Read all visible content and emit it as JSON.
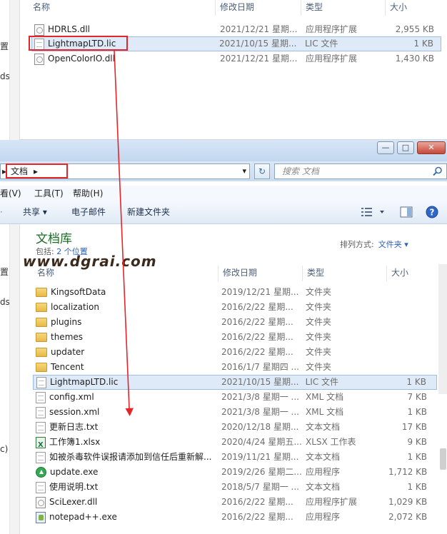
{
  "top_window": {
    "left_labels": [
      "置",
      "ds"
    ],
    "columns": [
      "名称",
      "修改日期",
      "类型",
      "大小"
    ],
    "files": [
      {
        "name": "HDRLS.dll",
        "date": "2021/12/21 星期...",
        "type": "应用程序扩展",
        "size": "2,955 KB",
        "icon": "dll-icon"
      },
      {
        "name": "LightmapLTD.lic",
        "date": "2021/10/15 星期...",
        "type": "LIC 文件",
        "size": "1 KB",
        "icon": "doc-icon"
      },
      {
        "name": "OpenColorIO.dll",
        "date": "2021/12/21 星期...",
        "type": "应用程序扩展",
        "size": "1,430 KB",
        "icon": "dll-icon"
      }
    ]
  },
  "bottom_window": {
    "window_buttons": {
      "min": "—",
      "max": "□",
      "close": "✕"
    },
    "breadcrumb": "文档",
    "breadcrumb_arrow_left": "▸",
    "breadcrumb_arrow_right": "▸",
    "dropdown_arrow": "▾",
    "refresh": "↻",
    "search_placeholder": "搜索 文档",
    "menu": [
      {
        "label": "看(V)"
      },
      {
        "label": "工具(T)"
      },
      {
        "label": "帮助(H)"
      }
    ],
    "commands": {
      "share": "共享 ▾",
      "email": "电子邮件",
      "new_folder": "新建文件夹"
    },
    "left_labels": [
      "置",
      "ds",
      "c)"
    ],
    "library_title": "文档库",
    "library_sub_prefix": "包括:",
    "library_sub_link": "2 个位置",
    "arrange_label": "排列方式:",
    "arrange_value": "文件夹 ▾",
    "columns": [
      "名称",
      "修改日期",
      "类型",
      "大小"
    ],
    "files": [
      {
        "name": "KingsoftData",
        "date": "2019/12/21 星期...",
        "type": "文件夹",
        "size": "",
        "icon": "folder-icon"
      },
      {
        "name": "localization",
        "date": "2016/2/22 星期...",
        "type": "文件夹",
        "size": "",
        "icon": "folder-icon"
      },
      {
        "name": "plugins",
        "date": "2016/2/22 星期...",
        "type": "文件夹",
        "size": "",
        "icon": "folder-icon"
      },
      {
        "name": "themes",
        "date": "2016/2/22 星期...",
        "type": "文件夹",
        "size": "",
        "icon": "folder-icon"
      },
      {
        "name": "updater",
        "date": "2016/2/22 星期...",
        "type": "文件夹",
        "size": "",
        "icon": "folder-icon"
      },
      {
        "name": "Tencent",
        "date": "2016/1/7 星期四 ...",
        "type": "文件夹",
        "size": "",
        "icon": "folder-icon"
      },
      {
        "name": "LightmapLTD.lic",
        "date": "2021/10/15 星期...",
        "type": "LIC 文件",
        "size": "1 KB",
        "icon": "doc-icon"
      },
      {
        "name": "config.xml",
        "date": "2021/3/8 星期一 ...",
        "type": "XML 文档",
        "size": "7 KB",
        "icon": "xml-icon"
      },
      {
        "name": "session.xml",
        "date": "2021/3/8 星期一 ...",
        "type": "XML 文档",
        "size": "1 KB",
        "icon": "xml-icon"
      },
      {
        "name": "更新日志.txt",
        "date": "2020/12/18 星期...",
        "type": "文本文档",
        "size": "17 KB",
        "icon": "doc-icon"
      },
      {
        "name": "工作簿1.xlsx",
        "date": "2020/4/24 星期五...",
        "type": "XLSX 工作表",
        "size": "9 KB",
        "icon": "xlsx-icon"
      },
      {
        "name": "如被杀毒软件误报请添加到信任后重新解...",
        "date": "2019/11/21 星期...",
        "type": "文本文档",
        "size": "1 KB",
        "icon": "doc-icon"
      },
      {
        "name": "update.exe",
        "date": "2019/2/26 星期二...",
        "type": "应用程序",
        "size": "1,712 KB",
        "icon": "exe-icon"
      },
      {
        "name": "使用说明.txt",
        "date": "2018/5/7 星期一 ...",
        "type": "文本文档",
        "size": "1 KB",
        "icon": "doc-icon"
      },
      {
        "name": "SciLexer.dll",
        "date": "2016/2/22 星期...",
        "type": "应用程序扩展",
        "size": "1,029 KB",
        "icon": "dll-icon"
      },
      {
        "name": "notepad++.exe",
        "date": "2016/2/22 星期...",
        "type": "应用程序",
        "size": "2,072 KB",
        "icon": "notepad-icon"
      }
    ]
  },
  "watermark": "www.dgrai.com",
  "colors": {
    "annotation": "#e4262a",
    "selection": "#dfeaf8",
    "library_title": "#1e6b28"
  }
}
